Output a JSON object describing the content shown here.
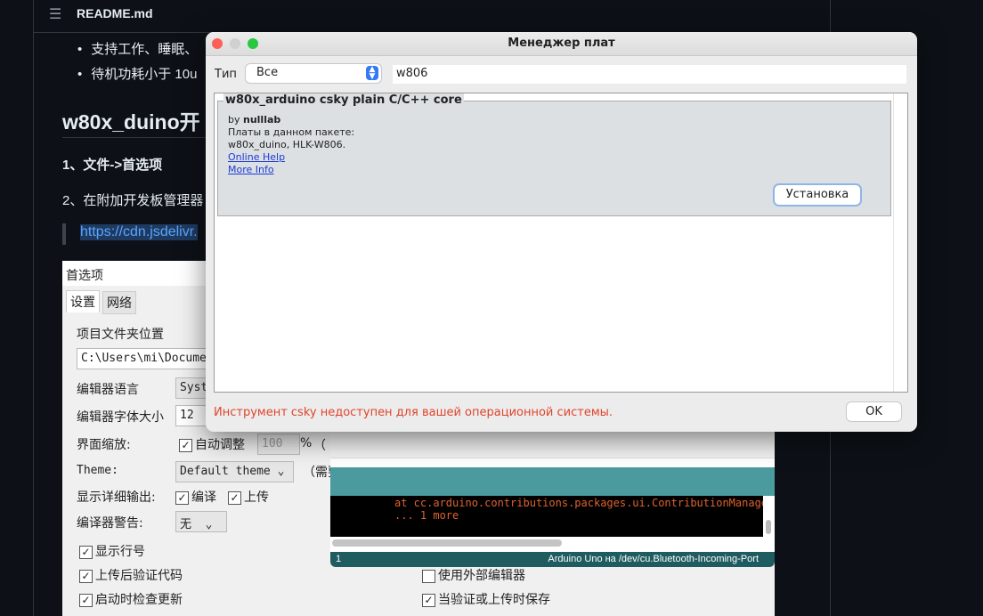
{
  "readme": {
    "file": "README.md",
    "bullets": [
      "支持工作、睡眠、",
      "待机功耗小于 10u"
    ],
    "heading": "w80x_duino开",
    "step1": "1、文件->首选项",
    "step2": "2、在附加开发板管理器",
    "link": "https://cdn.jsdelivr."
  },
  "prefs": {
    "title": "首选项",
    "tabs": [
      "设置",
      "网络"
    ],
    "sketchbook_label": "项目文件夹位置",
    "sketchbook_path": "C:\\Users\\mi\\Docume",
    "language_label": "编辑器语言",
    "language_value": "Syst",
    "fontsize_label": "编辑器字体大小",
    "fontsize_value": "12",
    "scale_label": "界面缩放:",
    "scale_auto": "自动调整",
    "scale_value": "100",
    "scale_pct": "%",
    "scale_note": "（",
    "theme_label": "Theme:",
    "theme_value": "Default theme",
    "theme_note": "（需要",
    "verbose_label": "显示详细输出:",
    "verbose_compile": "编译",
    "verbose_upload": "上传",
    "warnings_label": "编译器警告:",
    "warnings_value": "无",
    "checkboxes": [
      {
        "label": "显示行号",
        "checked": "✓"
      },
      {
        "label": "上传后验证代码",
        "checked": "✓"
      },
      {
        "label": "启动时检查更新",
        "checked": "✓"
      },
      {
        "label": "使用外部编辑器",
        "checked": ""
      },
      {
        "label": "当验证或上传时保存",
        "checked": "✓"
      }
    ]
  },
  "ide": {
    "console": [
      "at cc.arduino.contributions.packages.ui.ContributionManager",
      "... 1 more"
    ],
    "line": "1",
    "board": "Arduino Uno на /dev/cu.Bluetooth-Incoming-Port"
  },
  "boards": {
    "title": "Менеджер плат",
    "type_label": "Тип",
    "type_value": "Все",
    "search": "w806",
    "item": {
      "name": "w80x_arduino csky plain C/C++ core",
      "by": "by ",
      "author": "nulllab",
      "boards_label": "Платы в данном пакете:",
      "boards": "w80x_duino, HLK-W806.",
      "online_help": "Online Help",
      "more_info": "More Info",
      "install": "Установка"
    },
    "error": "Инструмент csky недоступен для вашей операционной системы.",
    "ok": "OK"
  },
  "colors": {
    "error": "#e0442c",
    "teal": "#4a9a9e",
    "teal_dark": "#1f5c60"
  }
}
